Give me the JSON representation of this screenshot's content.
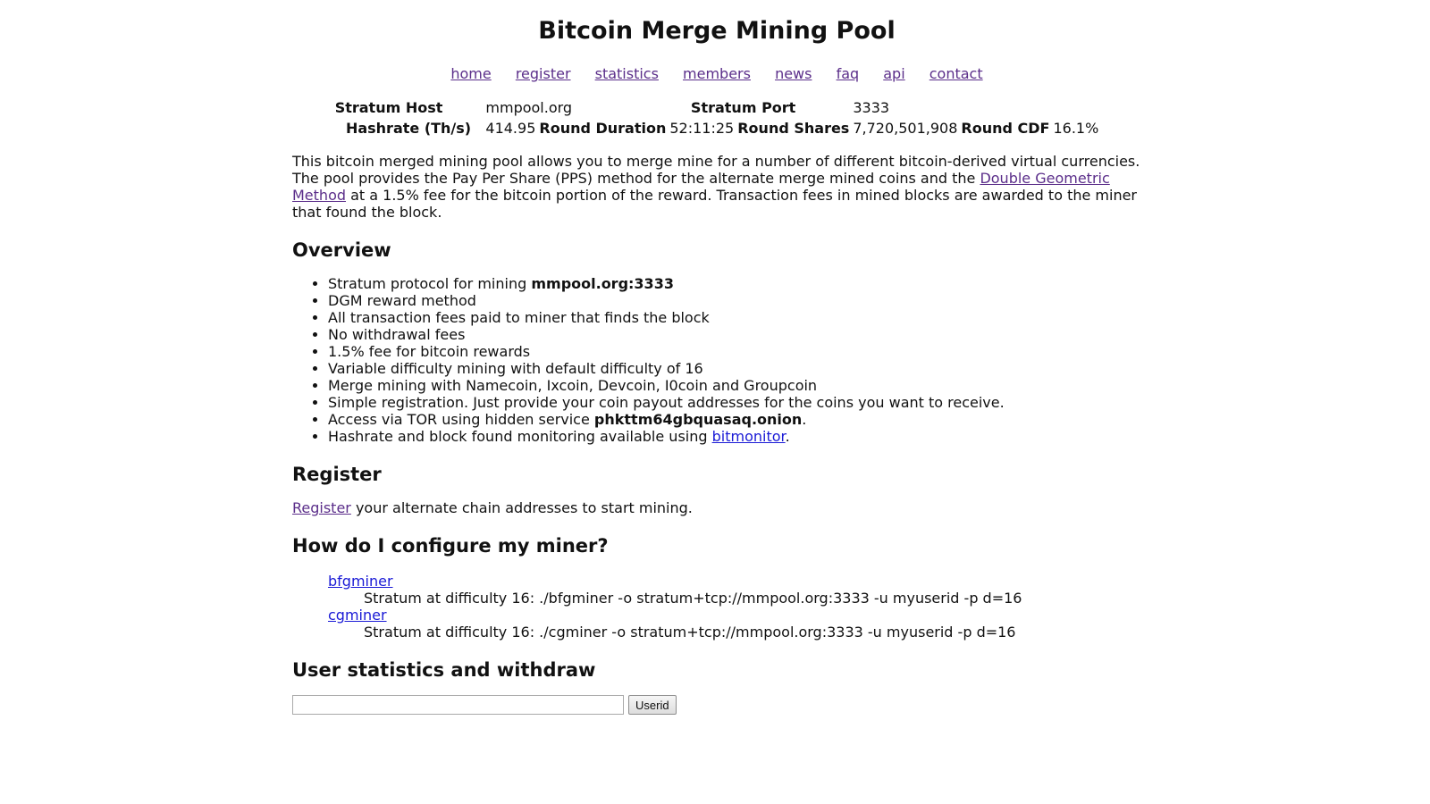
{
  "title": "Bitcoin Merge Mining Pool",
  "nav": [
    "home",
    "register",
    "statistics",
    "members",
    "news",
    "faq",
    "api",
    "contact"
  ],
  "stats": {
    "stratum_host_label": "Stratum Host",
    "stratum_host_value": "mmpool.org",
    "stratum_port_label": "Stratum Port",
    "stratum_port_value": "3333",
    "hashrate_label": "Hashrate (Th/s)",
    "hashrate_value": "414.95",
    "round_duration_label": "Round Duration",
    "round_duration_value": "52:11:25",
    "round_shares_label": "Round Shares",
    "round_shares_value": "7,720,501,908",
    "round_cdf_label": "Round CDF",
    "round_cdf_value": "16.1%"
  },
  "intro": {
    "before_link": "This bitcoin merged mining pool allows you to merge mine for a number of different bitcoin-derived virtual currencies. The pool provides the Pay Per Share (PPS) method for the alternate merge mined coins and the ",
    "link": "Double Geometric Method",
    "after_link": " at a 1.5% fee for the bitcoin portion of the reward. Transaction fees in mined blocks are awarded to the miner that found the block."
  },
  "overview": {
    "heading": "Overview",
    "items": [
      {
        "text": "Stratum protocol for mining ",
        "bold": "mmpool.org:3333",
        "link": "",
        "after": ""
      },
      {
        "text": "DGM reward method",
        "bold": "",
        "link": "",
        "after": ""
      },
      {
        "text": "All transaction fees paid to miner that finds the block",
        "bold": "",
        "link": "",
        "after": ""
      },
      {
        "text": "No withdrawal fees",
        "bold": "",
        "link": "",
        "after": ""
      },
      {
        "text": "1.5% fee for bitcoin rewards",
        "bold": "",
        "link": "",
        "after": ""
      },
      {
        "text": "Variable difficulty mining with default difficulty of 16",
        "bold": "",
        "link": "",
        "after": ""
      },
      {
        "text": "Merge mining with Namecoin, Ixcoin, Devcoin, I0coin and Groupcoin",
        "bold": "",
        "link": "",
        "after": ""
      },
      {
        "text": "Simple registration. Just provide your coin payout addresses for the coins you want to receive.",
        "bold": "",
        "link": "",
        "after": ""
      },
      {
        "text": "Access via TOR using hidden service ",
        "bold": "phkttm64gbquasaq.onion",
        "link": "",
        "after": "."
      },
      {
        "text": "Hashrate and block found monitoring available using ",
        "bold": "",
        "link": "bitmonitor",
        "after": "."
      }
    ]
  },
  "register": {
    "heading": "Register",
    "link": "Register",
    "text": " your alternate chain addresses to start mining."
  },
  "configure": {
    "heading": "How do I configure my miner?",
    "miners": [
      {
        "name": "bfgminer",
        "command": "Stratum at difficulty 16: ./bfgminer -o stratum+tcp://mmpool.org:3333 -u myuserid -p d=16"
      },
      {
        "name": "cgminer",
        "command": "Stratum at difficulty 16: ./cgminer -o stratum+tcp://mmpool.org:3333 -u myuserid -p d=16"
      }
    ]
  },
  "user_stats": {
    "heading": "User statistics and withdraw",
    "input_value": "",
    "button_label": "Userid"
  },
  "colors": {
    "visited_link": "#5b2e8a",
    "link": "#1a1ad6",
    "text": "#111111",
    "background": "#ffffff"
  }
}
